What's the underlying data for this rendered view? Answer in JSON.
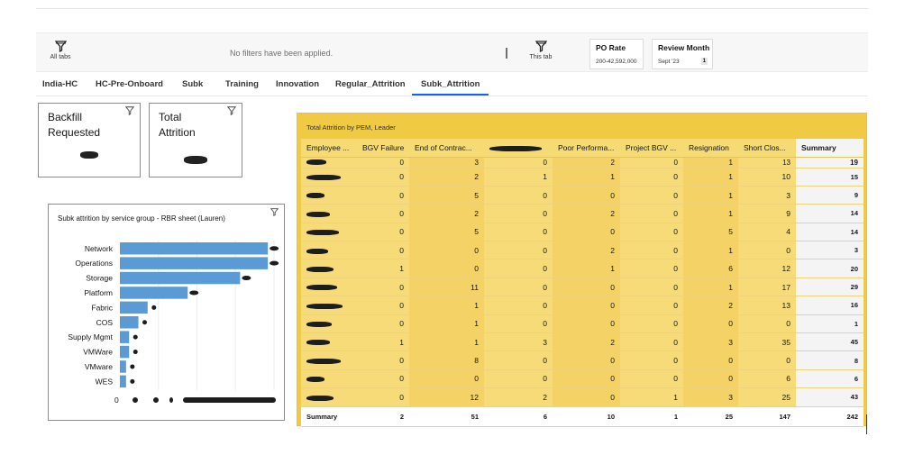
{
  "filter_bar": {
    "all_tabs_label": "All tabs",
    "no_filters_text": "No filters have been applied.",
    "this_tab_label": "This tab",
    "chips": [
      {
        "title": "PO Rate",
        "value": "200-42,592,000"
      },
      {
        "title": "Review Month",
        "value": "Sept '23",
        "badge": "1"
      }
    ]
  },
  "tabs": [
    {
      "label": "India-HC",
      "active": false
    },
    {
      "label": "HC-Pre-Onboard",
      "active": false
    },
    {
      "label": "Subk",
      "active": false
    },
    {
      "label": "Training",
      "active": false
    },
    {
      "label": "Innovation",
      "active": false
    },
    {
      "label": "Regular_Attrition",
      "active": false
    },
    {
      "label": "Subk_Attrition",
      "active": true
    }
  ],
  "kpis": [
    {
      "title_line1": "Backfill",
      "title_line2": "Requested"
    },
    {
      "title_line1": "Total",
      "title_line2": "Attrition"
    }
  ],
  "bar_chart": {
    "title": "Subk attrition by service group - RBR sheet (Lauren)",
    "x_tick_zero": "0",
    "bar_color": "#5b9bd5"
  },
  "chart_data": {
    "type": "bar",
    "orientation": "horizontal",
    "title": "Subk attrition by service group - RBR sheet (Lauren)",
    "categories": [
      "Network",
      "Operations",
      "Storage",
      "Platform",
      "Fabric",
      "COS",
      "Supply Mgmt",
      "VMWare",
      "VMware",
      "WES"
    ],
    "values": [
      48,
      48,
      39,
      22,
      9,
      6,
      3,
      3,
      2,
      2
    ],
    "xlim": [
      0,
      50
    ]
  },
  "attrition_table": {
    "title": "Total Attrition by PEM, Leader",
    "columns": [
      "Employee ...",
      "BGV Failure",
      "End of Contrac...",
      "",
      "Poor Performa...",
      "Project BGV ...",
      "Resignation",
      "Short Clos...",
      "Summary"
    ],
    "rows": [
      {
        "values": [
          "0",
          "3",
          "0",
          "2",
          "0",
          "1",
          "13"
        ],
        "summary": "19"
      },
      {
        "values": [
          "0",
          "2",
          "1",
          "1",
          "0",
          "1",
          "10"
        ],
        "summary": "15"
      },
      {
        "values": [
          "0",
          "5",
          "0",
          "0",
          "0",
          "1",
          "3"
        ],
        "summary": "9"
      },
      {
        "values": [
          "0",
          "2",
          "0",
          "2",
          "0",
          "1",
          "9"
        ],
        "summary": "14"
      },
      {
        "values": [
          "0",
          "5",
          "0",
          "0",
          "0",
          "5",
          "4"
        ],
        "summary": "14"
      },
      {
        "values": [
          "0",
          "0",
          "0",
          "2",
          "0",
          "1",
          "0"
        ],
        "summary": "3"
      },
      {
        "values": [
          "1",
          "0",
          "0",
          "1",
          "0",
          "6",
          "12"
        ],
        "summary": "20"
      },
      {
        "values": [
          "0",
          "11",
          "0",
          "0",
          "0",
          "1",
          "17"
        ],
        "summary": "29"
      },
      {
        "values": [
          "0",
          "1",
          "0",
          "0",
          "0",
          "2",
          "13"
        ],
        "summary": "16"
      },
      {
        "values": [
          "0",
          "1",
          "0",
          "0",
          "0",
          "0",
          "0"
        ],
        "summary": "1"
      },
      {
        "values": [
          "1",
          "1",
          "3",
          "2",
          "0",
          "3",
          "35"
        ],
        "summary": "45"
      },
      {
        "values": [
          "0",
          "8",
          "0",
          "0",
          "0",
          "0",
          "0"
        ],
        "summary": "8"
      },
      {
        "values": [
          "0",
          "0",
          "0",
          "0",
          "0",
          "0",
          "6"
        ],
        "summary": "6"
      },
      {
        "values": [
          "0",
          "12",
          "2",
          "0",
          "1",
          "3",
          "25"
        ],
        "summary": "43"
      }
    ],
    "total": {
      "label": "Summary",
      "values": [
        "2",
        "51",
        "6",
        "10",
        "1",
        "25",
        "147"
      ],
      "summary": "242"
    }
  }
}
